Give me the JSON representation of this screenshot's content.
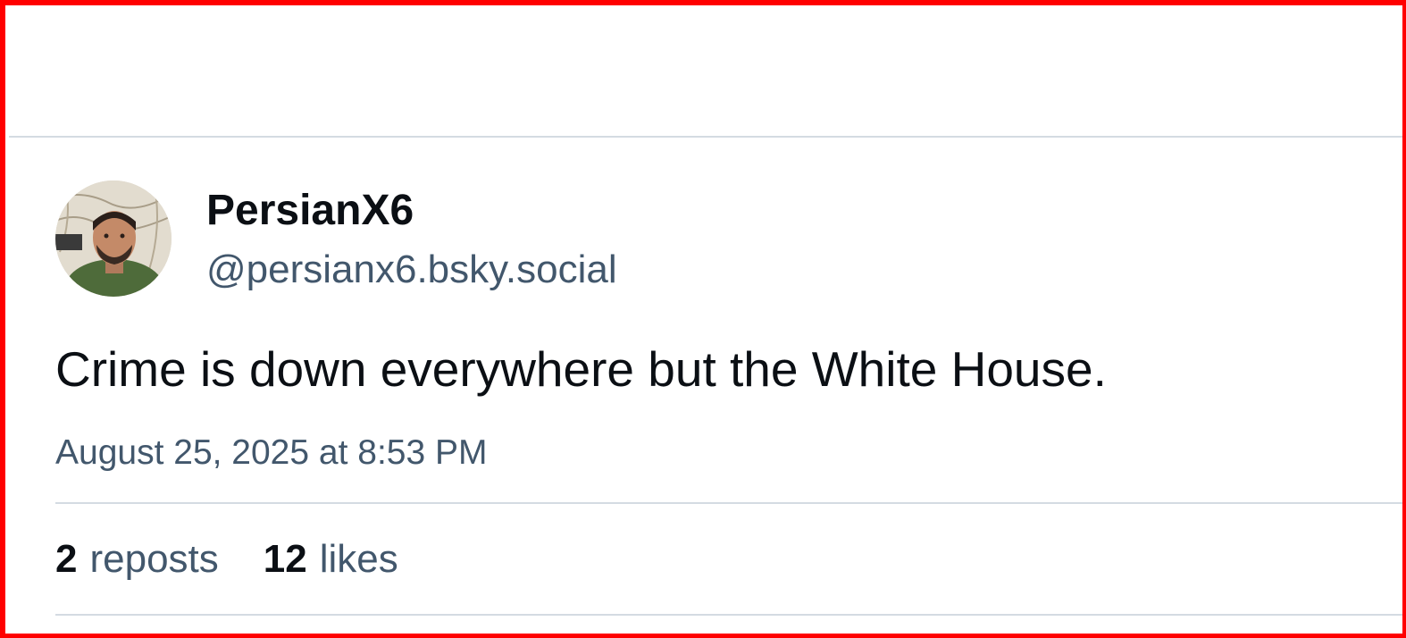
{
  "post": {
    "author": {
      "display_name": "PersianX6",
      "handle": "@persianx6.bsky.social",
      "avatar_icon": "user-avatar-photo"
    },
    "text": "Crime is down everywhere but the White House.",
    "timestamp": "August 25, 2025 at 8:53 PM",
    "stats": {
      "reposts_count": "2",
      "reposts_label": "reposts",
      "likes_count": "12",
      "likes_label": "likes"
    }
  },
  "colors": {
    "border": "#ff0000",
    "text_primary": "#0b0f14",
    "text_secondary": "#42576c",
    "divider": "#d4dbe2"
  }
}
